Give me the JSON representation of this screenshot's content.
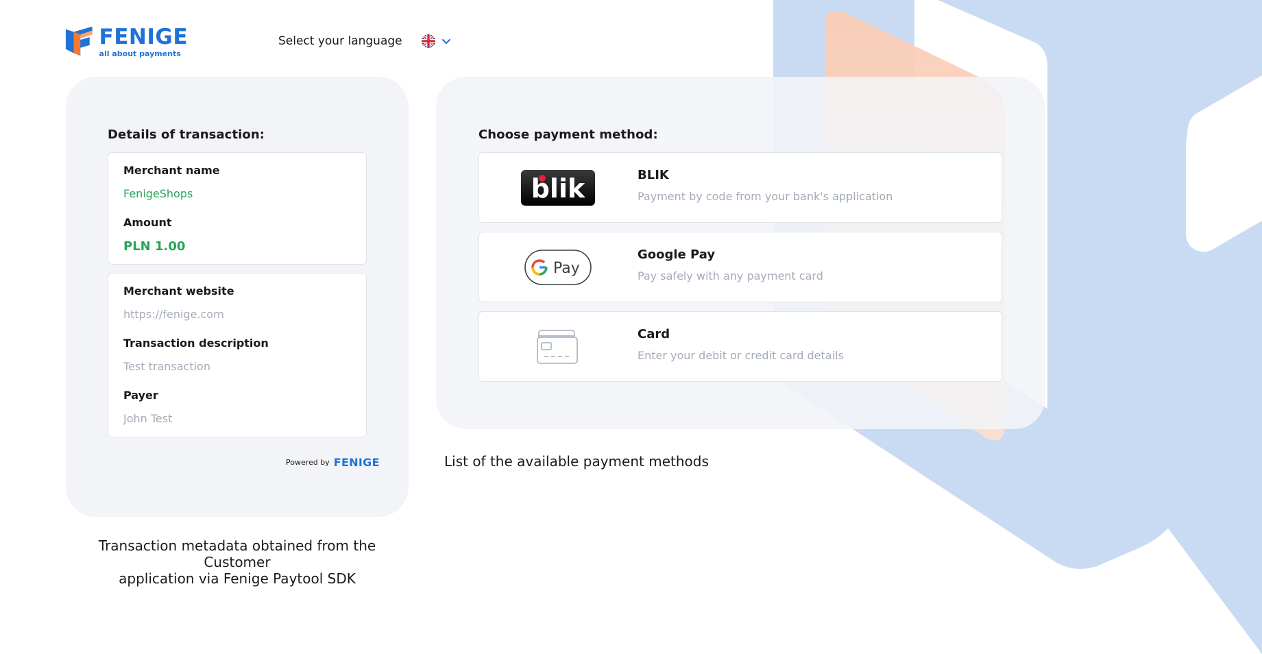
{
  "header": {
    "logo_word": "FENIGE",
    "logo_tagline": "all about payments",
    "language_label": "Select your language",
    "language_flag_icon": "uk-flag-icon",
    "language_chevron_icon": "chevron-down-icon"
  },
  "transaction": {
    "title": "Details of transaction:",
    "merchant_name_label": "Merchant name",
    "merchant_name_value": "FenigeShops",
    "amount_label": "Amount",
    "amount_value": "PLN 1.00",
    "merchant_website_label": "Merchant website",
    "merchant_website_value": "https://fenige.com",
    "description_label": "Transaction description",
    "description_value": "Test transaction",
    "payer_label": "Payer",
    "payer_value": "John Test",
    "powered_by_label": "Powered by",
    "powered_by_brand": "FENIGE"
  },
  "payment": {
    "title": "Choose payment method:",
    "methods": [
      {
        "name": "BLIK",
        "description": "Payment by code from your bank's application",
        "logo_text": "blik",
        "icon": "blik-logo-icon"
      },
      {
        "name": "Google Pay",
        "description": "Pay safely with any payment card",
        "logo_text": "Pay",
        "icon": "google-pay-logo-icon"
      },
      {
        "name": "Card",
        "description": "Enter your debit or credit card details",
        "icon": "credit-card-icon"
      }
    ]
  },
  "captions": {
    "left_line1": "Transaction metadata obtained from the Customer",
    "left_line2": "application via Fenige Paytool SDK",
    "right": "List of the available payment methods"
  },
  "colors": {
    "brand_blue": "#1f72d6",
    "amount_green": "#27a35a",
    "panel_bg": "#f3f4f7",
    "decor_blue": "#c8dbf2",
    "decor_peach": "#f8cfbd"
  }
}
